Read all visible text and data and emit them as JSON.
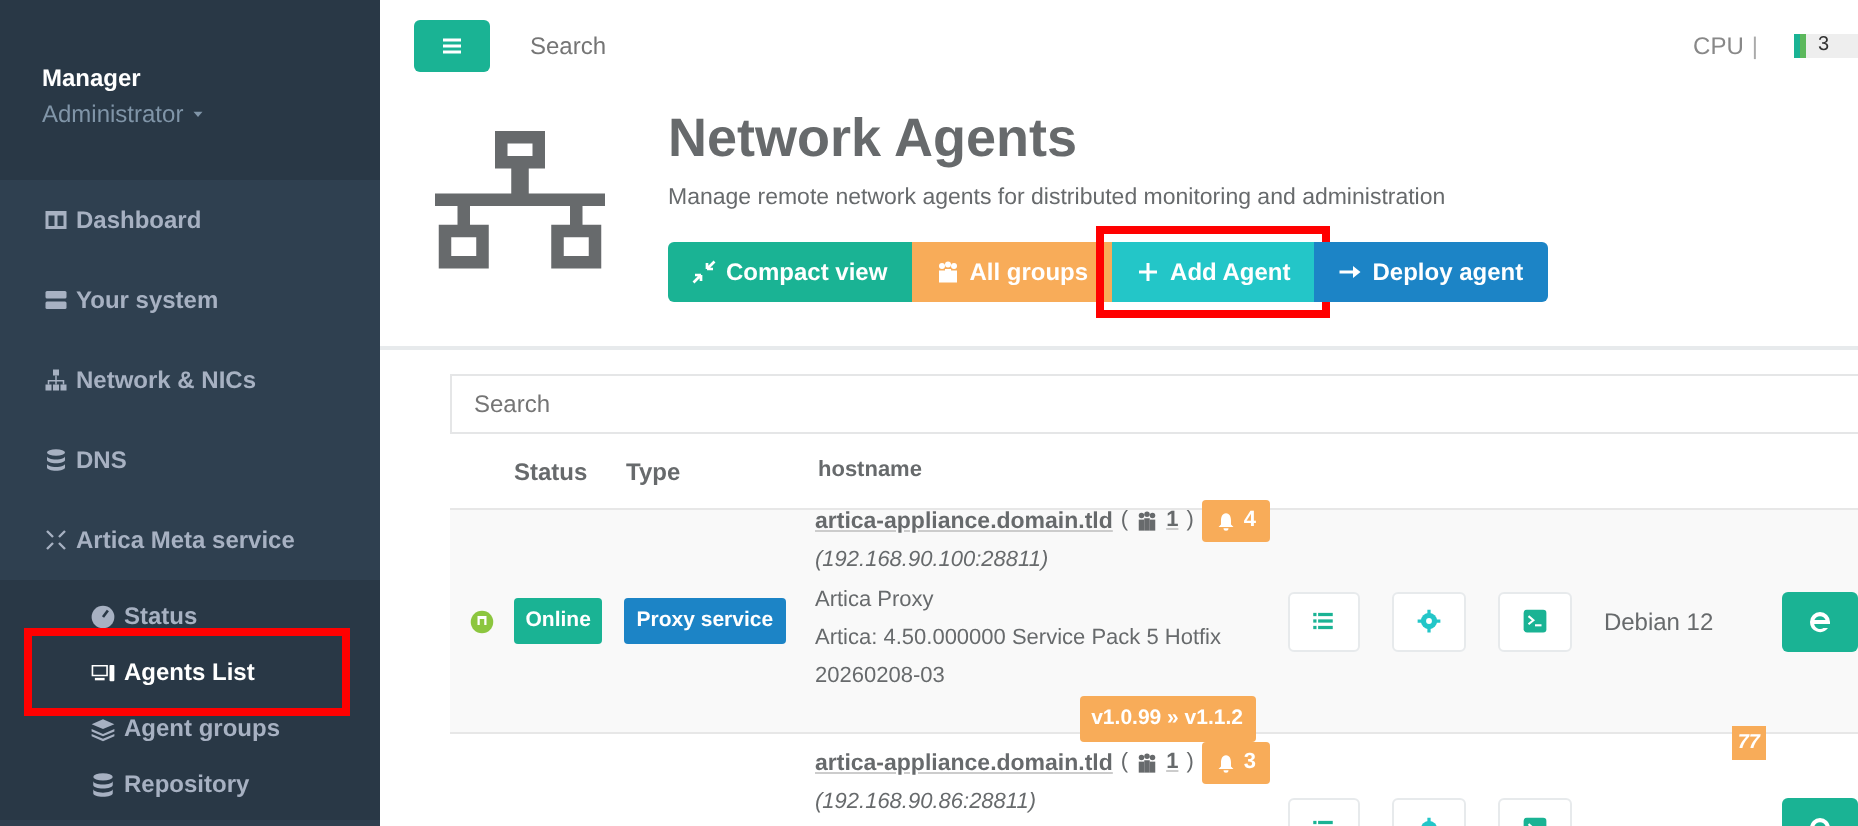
{
  "topbar": {
    "search_placeholder": "Search",
    "cpu": {
      "label": "CPU",
      "separator": "|",
      "level": 0.06,
      "reading": "3"
    }
  },
  "sidebar": {
    "user": "Manager",
    "role": "Administrator",
    "items": [
      {
        "label": "Dashboard",
        "kind": "dashboard",
        "selected": false
      },
      {
        "label": "Your system",
        "kind": "server",
        "selected": false
      },
      {
        "label": "Network & NICs",
        "kind": "sitemap",
        "selected": false
      },
      {
        "label": "DNS",
        "kind": "database",
        "selected": false
      },
      {
        "label": "Artica Meta service",
        "kind": "meta",
        "selected": false,
        "children": [
          {
            "label": "Status",
            "kind": "gauge",
            "selected": false,
            "highlighted": false
          },
          {
            "label": "Agents List",
            "kind": "agents",
            "selected": true,
            "highlighted": true
          },
          {
            "label": "Agent groups",
            "kind": "layers",
            "selected": false,
            "highlighted": false
          },
          {
            "label": "Repository",
            "kind": "database",
            "selected": false,
            "highlighted": false
          }
        ]
      }
    ]
  },
  "header": {
    "title": "Network Agents",
    "description": "Manage remote network agents for distributed monitoring and administration",
    "buttons": [
      {
        "label": "Compact view",
        "kind": "compact",
        "highlighted": false
      },
      {
        "label": "All groups",
        "kind": "groups",
        "highlighted": false
      },
      {
        "label": "Add Agent",
        "kind": "add",
        "highlighted": true
      },
      {
        "label": "Deploy agent",
        "kind": "deploy",
        "highlighted": false
      }
    ]
  },
  "table": {
    "search_placeholder": "Search",
    "columns": [
      "Status",
      "Type",
      "hostname"
    ],
    "rows": [
      {
        "color": "#8cc63f",
        "status": "Online",
        "type": "Proxy service",
        "hostname": "artica-appliance.domain.tld",
        "open": "(",
        "groups": "1",
        "close": ")",
        "alerts": "4",
        "ip": "(192.168.90.100:28811)",
        "product": "Artica Proxy",
        "version": "Artica: 4.50.000000 Service Pack 5 Hotfix 20260208-03",
        "update": "v1.0.99 » v1.1.2",
        "os": "Debian 12"
      },
      {
        "hostname": "artica-appliance.domain.tld",
        "open": "(",
        "groups": "1",
        "close": ")",
        "alerts": "3",
        "ip": "(192.168.90.86:28811)",
        "notice": "77"
      }
    ]
  }
}
